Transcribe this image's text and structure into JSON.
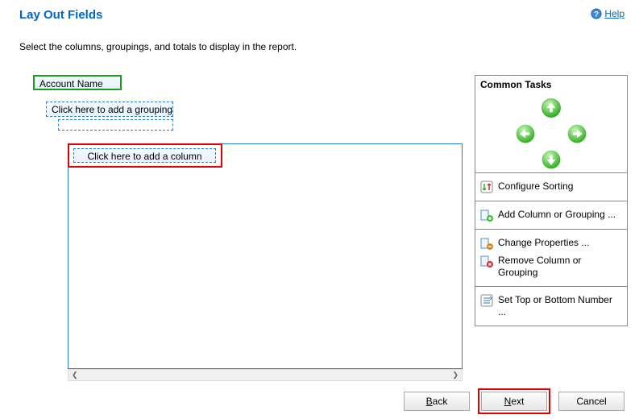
{
  "header": {
    "title": "Lay Out Fields",
    "help_label": "Help"
  },
  "instruction": "Select the columns, groupings, and totals to display in the report.",
  "fields": {
    "account_name": "Account Name",
    "add_grouping": "Click here to add a grouping",
    "add_column": "Click here to add a column"
  },
  "tasks": {
    "title": "Common Tasks",
    "configure_sorting": "Configure Sorting",
    "add_column_grouping": "Add Column or Grouping ...",
    "change_properties": "Change Properties ...",
    "remove_column_grouping": "Remove Column or Grouping",
    "set_top_bottom": "Set Top or Bottom Number ..."
  },
  "footer": {
    "back": "Back",
    "next": "Next",
    "cancel": "Cancel"
  }
}
